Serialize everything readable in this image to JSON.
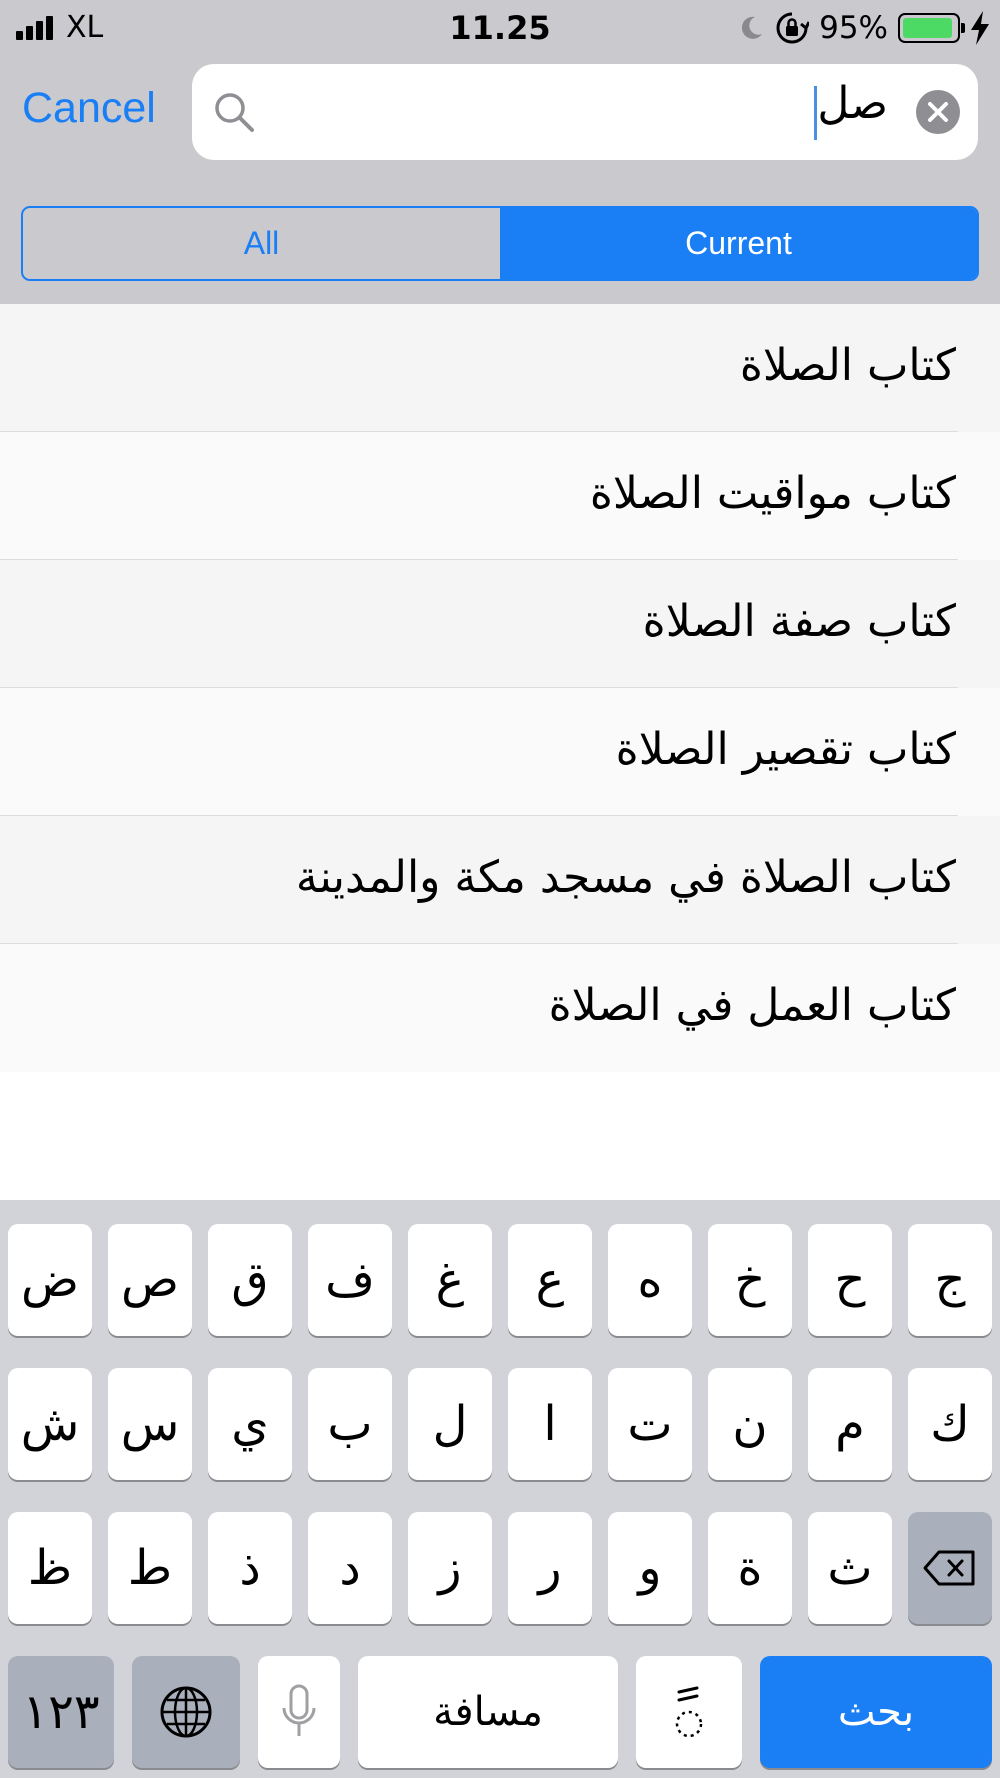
{
  "status": {
    "carrier": "XL",
    "time": "11.25",
    "battery_percent": "95%",
    "battery_level": 0.95,
    "icons": [
      "signal-icon",
      "moon-icon",
      "rotation-lock-icon",
      "battery-icon",
      "charging-icon"
    ]
  },
  "search": {
    "cancel_label": "Cancel",
    "value": "صل"
  },
  "scope": {
    "options": [
      "All",
      "Current"
    ],
    "selected": "Current"
  },
  "results": [
    "كتاب الصلاة",
    "كتاب مواقيت الصلاة",
    "كتاب صفة الصلاة",
    "كتاب تقصير الصلاة",
    "كتاب الصلاة في مسجد مكة والمدينة",
    "كتاب العمل في الصلاة"
  ],
  "keyboard": {
    "row1": [
      "ض",
      "ص",
      "ق",
      "ف",
      "غ",
      "ع",
      "ه",
      "خ",
      "ح",
      "ج"
    ],
    "row2": [
      "ش",
      "س",
      "ي",
      "ب",
      "ل",
      "ا",
      "ت",
      "ن",
      "م",
      "ك"
    ],
    "row3": [
      "ظ",
      "ط",
      "ذ",
      "د",
      "ز",
      "ر",
      "و",
      "ة",
      "ث"
    ],
    "numbers_label": "١٢٣",
    "space_label": "مسافة",
    "tanween_label": "ً",
    "search_label": "بحث"
  },
  "colors": {
    "accent": "#1a7ef5",
    "battery": "#4cd964"
  }
}
